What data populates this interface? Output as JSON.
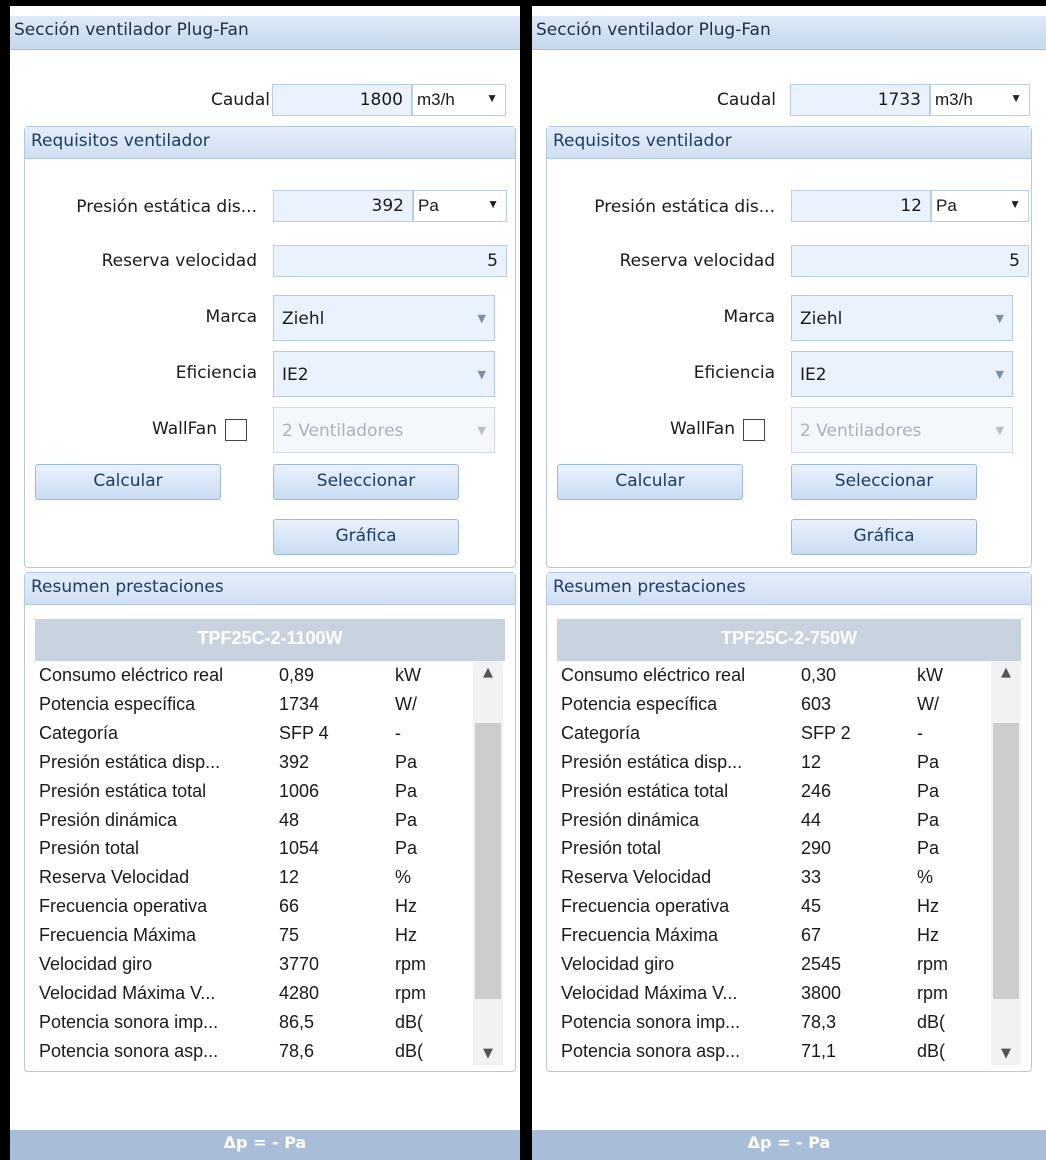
{
  "left": {
    "header": "Sección ventilador Plug-Fan",
    "caudal": {
      "label": "Caudal",
      "value": "1800",
      "unit": "m3/h"
    },
    "req_title": "Requisitos ventilador",
    "presion": {
      "label": "Presión estática dis...",
      "value": "392",
      "unit": "Pa"
    },
    "reserva": {
      "label": "Reserva velocidad",
      "value": "5"
    },
    "marca": {
      "label": "Marca",
      "value": "Ziehl"
    },
    "eficiencia": {
      "label": "Eficiencia",
      "value": "IE2"
    },
    "wallfan": {
      "label": "WallFan",
      "value": "2 Ventiladores"
    },
    "buttons": {
      "calcular": "Calcular",
      "seleccionar": "Seleccionar",
      "grafica": "Gráfica"
    },
    "resumen_title": "Resumen prestaciones",
    "model": "TPF25C-2-1100W",
    "rows": [
      [
        "Consumo eléctrico real",
        "0,89",
        "kW"
      ],
      [
        "Potencia específica",
        "1734",
        "W/"
      ],
      [
        "Categoría",
        "SFP 4",
        "-"
      ],
      [
        "Presión estática disp...",
        "392",
        "Pa"
      ],
      [
        "Presión estática total",
        "1006",
        "Pa"
      ],
      [
        "Presión dinámica",
        "48",
        "Pa"
      ],
      [
        "Presión total",
        "1054",
        "Pa"
      ],
      [
        "Reserva Velocidad",
        "12",
        "%"
      ],
      [
        "Frecuencia operativa",
        "66",
        "Hz"
      ],
      [
        "Frecuencia Máxima",
        "75",
        "Hz"
      ],
      [
        "Velocidad giro",
        "3770",
        "rpm"
      ],
      [
        "Velocidad Máxima V...",
        "4280",
        "rpm"
      ],
      [
        "Potencia sonora imp...",
        "86,5",
        "dB("
      ],
      [
        "Potencia sonora asp...",
        "78,6",
        "dB("
      ]
    ],
    "footer": "Δp = - Pa"
  },
  "right": {
    "header": "Sección ventilador Plug-Fan",
    "caudal": {
      "label": "Caudal",
      "value": "1733",
      "unit": "m3/h"
    },
    "req_title": "Requisitos ventilador",
    "presion": {
      "label": "Presión estática dis...",
      "value": "12",
      "unit": "Pa"
    },
    "reserva": {
      "label": "Reserva velocidad",
      "value": "5"
    },
    "marca": {
      "label": "Marca",
      "value": "Ziehl"
    },
    "eficiencia": {
      "label": "Eficiencia",
      "value": "IE2"
    },
    "wallfan": {
      "label": "WallFan",
      "value": "2 Ventiladores"
    },
    "buttons": {
      "calcular": "Calcular",
      "seleccionar": "Seleccionar",
      "grafica": "Gráfica"
    },
    "resumen_title": "Resumen prestaciones",
    "model": "TPF25C-2-750W",
    "rows": [
      [
        "Consumo eléctrico real",
        "0,30",
        "kW"
      ],
      [
        "Potencia específica",
        "603",
        "W/"
      ],
      [
        "Categoría",
        "SFP 2",
        "-"
      ],
      [
        "Presión estática disp...",
        "12",
        "Pa"
      ],
      [
        "Presión estática total",
        "246",
        "Pa"
      ],
      [
        "Presión dinámica",
        "44",
        "Pa"
      ],
      [
        "Presión total",
        "290",
        "Pa"
      ],
      [
        "Reserva Velocidad",
        "33",
        "%"
      ],
      [
        "Frecuencia operativa",
        "45",
        "Hz"
      ],
      [
        "Frecuencia Máxima",
        "67",
        "Hz"
      ],
      [
        "Velocidad giro",
        "2545",
        "rpm"
      ],
      [
        "Velocidad Máxima V...",
        "3800",
        "rpm"
      ],
      [
        "Potencia sonora imp...",
        "78,3",
        "dB("
      ],
      [
        "Potencia sonora asp...",
        "71,1",
        "dB("
      ]
    ],
    "footer": "Δp = - Pa"
  },
  "icons": {
    "dropdown": "chevron-down-icon",
    "scroll_up": "scroll-up-arrow-icon",
    "scroll_down": "scroll-down-arrow-icon"
  },
  "colors": {
    "header_bg": "#c6d8ee",
    "field_bg": "#eaf3fd",
    "button_bg": "#c9dcf2",
    "model_bar": "#c9d3e0",
    "footer_bar": "#a8bdd7"
  },
  "summary_scroll": {
    "position": 0.1,
    "visible_fraction": 0.8
  }
}
